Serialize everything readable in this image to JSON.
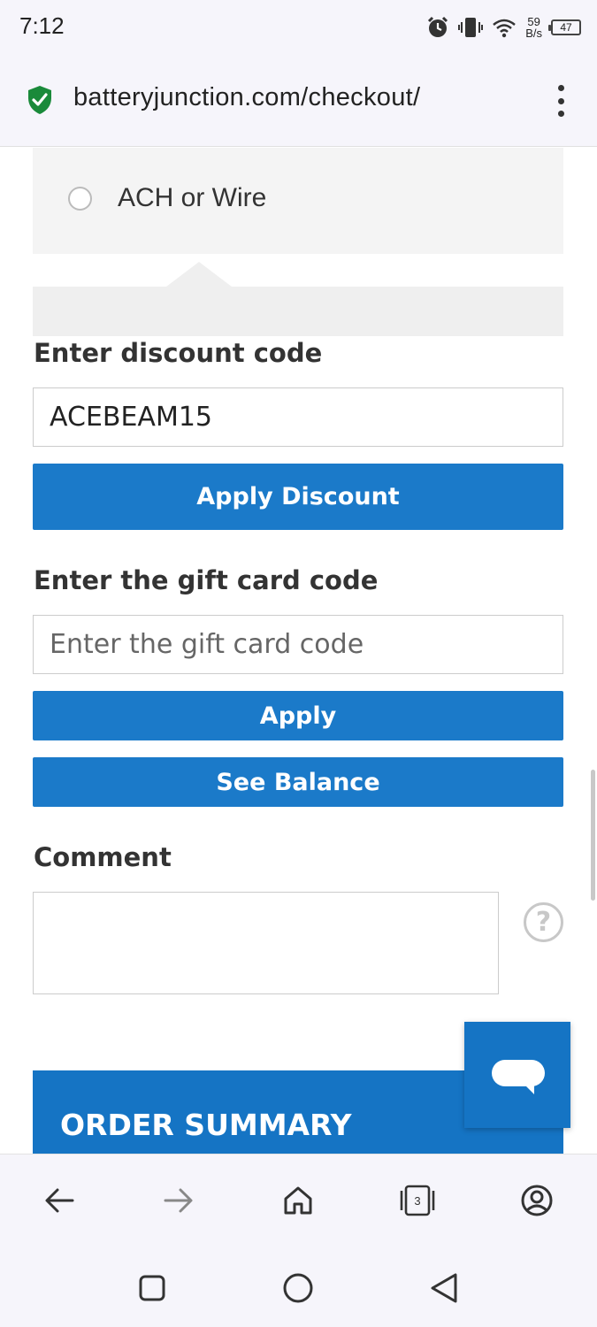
{
  "status_bar": {
    "time": "7:12",
    "net_speed_value": "59",
    "net_speed_unit": "B/s",
    "battery_level": "47",
    "icons": [
      "alarm-icon",
      "vibrate-icon",
      "wifi-icon",
      "battery-icon"
    ]
  },
  "browser": {
    "url": "batteryjunction.com/checkout/",
    "tab_count": "3",
    "secure_color": "#1a8a3a"
  },
  "payment": {
    "ach_label": "ACH or Wire"
  },
  "discount": {
    "label": "Enter discount code",
    "value": "ACEBEAM15",
    "button": "Apply Discount"
  },
  "gift_card": {
    "label": "Enter the gift card code",
    "placeholder": "Enter the gift card code",
    "apply_button": "Apply",
    "balance_button": "See Balance"
  },
  "comment": {
    "label": "Comment",
    "help_symbol": "?"
  },
  "order_summary": {
    "title": "ORDER SUMMARY"
  },
  "colors": {
    "primary_button": "#1b7ac9",
    "summary_header": "#1574c4"
  }
}
